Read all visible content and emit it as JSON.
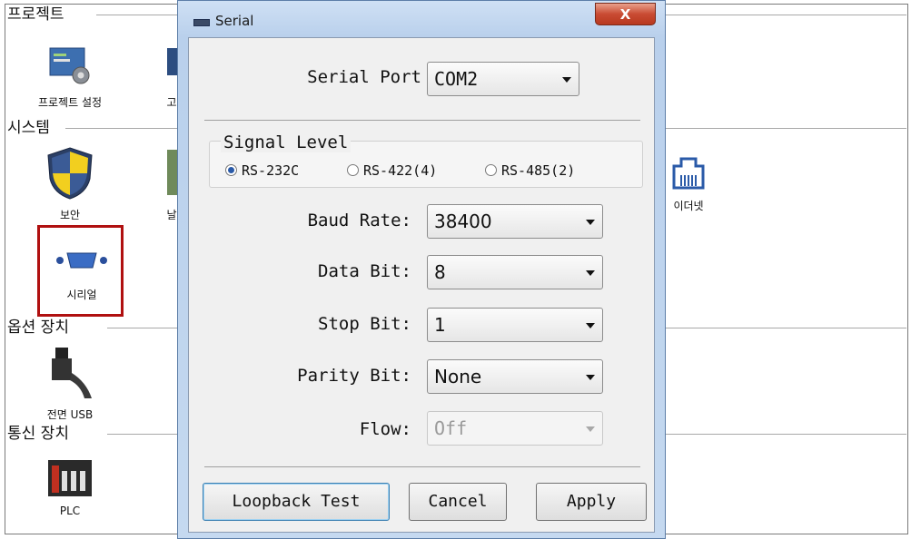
{
  "background": {
    "sections": [
      {
        "title": "프로젝트"
      },
      {
        "title": "시스템"
      },
      {
        "title": "옵션 장치"
      },
      {
        "title": "통신 장치"
      }
    ],
    "icons": {
      "project_settings": "프로젝트 설정",
      "partial_next_project": "고",
      "security": "보안",
      "partial_next_system": "날",
      "ethernet": "이더넷",
      "serial": "시리얼",
      "front_usb": "전면 USB",
      "plc": "PLC"
    }
  },
  "dialog": {
    "title": "Serial",
    "close_label": "X",
    "serial_port": {
      "label": "Serial Port",
      "value": "COM2"
    },
    "signal_level": {
      "title": "Signal Level",
      "options": [
        "RS-232C",
        "RS-422(4)",
        "RS-485(2)"
      ],
      "selected": "RS-232C"
    },
    "baud_rate": {
      "label": "Baud Rate:",
      "value": "38400"
    },
    "data_bit": {
      "label": "Data Bit:",
      "value": "8"
    },
    "stop_bit": {
      "label": "Stop Bit:",
      "value": "1"
    },
    "parity_bit": {
      "label": "Parity Bit:",
      "value": "None"
    },
    "flow": {
      "label": "Flow:",
      "value": "Off"
    },
    "buttons": {
      "loopback": "Loopback Test",
      "cancel": "Cancel",
      "apply": "Apply"
    }
  },
  "colors": {
    "highlight": "#b01010",
    "titlebar": "#c5d9f0",
    "close": "#c94b33"
  }
}
